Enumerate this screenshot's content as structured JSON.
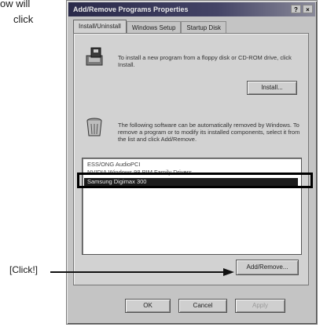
{
  "manual": {
    "line1": "ow will",
    "line2": "click"
  },
  "dialog": {
    "title": "Add/Remove Programs Properties",
    "title_buttons": [
      "?",
      "×"
    ],
    "tabs": [
      {
        "label": "Install/Uninstall",
        "active": true
      },
      {
        "label": "Windows Setup",
        "active": false
      },
      {
        "label": "Startup Disk",
        "active": false
      }
    ],
    "install_text": "To install a new program from a floppy disk or CD-ROM drive, click Install.",
    "install_button": "Install...",
    "remove_text": "The following software can be automatically removed by Windows. To remove a program or to modify its installed components, select it from the list and click Add/Remove.",
    "list_items": [
      "ESS/ONG AudioPCI",
      "NVIDIA Windows 98 PIM Family Drivers"
    ],
    "selected_item": "Samsung Digimax 300",
    "add_remove_button": "Add/Remove...",
    "ok_button": "OK",
    "cancel_button": "Cancel",
    "apply_button": "Apply"
  },
  "callout": {
    "label": "[Click!]"
  }
}
